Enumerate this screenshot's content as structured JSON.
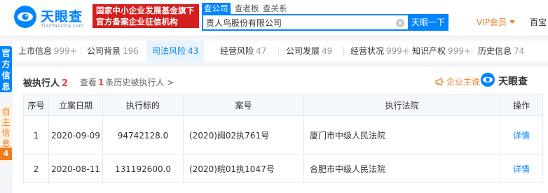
{
  "header": {
    "logo": {
      "name": "天眼查",
      "domain": "TianYanCha.com"
    },
    "banner": {
      "line1": "国家中小企业发展基金旗下",
      "line2": "官方备案企业征信机构"
    },
    "search_tabs": [
      {
        "label": "查公司",
        "active": true
      },
      {
        "label": "查老板",
        "active": false
      },
      {
        "label": "查关系",
        "active": false
      }
    ],
    "search": {
      "value": "贵人鸟股份有限公司",
      "button_label": "天眼一下"
    },
    "vip_label": "VIP会员",
    "app_label": "百宝"
  },
  "sidebar": {
    "official_label": "官方信息",
    "self_label": "自主信息",
    "self_count": "4"
  },
  "category_tabs": [
    {
      "label": "上市信息",
      "count": "999+",
      "active": false
    },
    {
      "label": "公司背景",
      "count": "196",
      "active": false
    },
    {
      "label": "司法风险",
      "count": "43",
      "active": true
    },
    {
      "label": "经营风险",
      "count": "47",
      "active": false
    },
    {
      "label": "公司发展",
      "count": "49",
      "active": false
    },
    {
      "label": "经营状况",
      "count": "999+",
      "active": false
    },
    {
      "label": "知识产权",
      "count": "999+",
      "active": false
    },
    {
      "label": "历史信息",
      "count": "74",
      "active": false
    }
  ],
  "section": {
    "title": "被执行人",
    "count": "2",
    "history_prefix": "查看",
    "history_count": "1",
    "history_suffix": "条历史被执行人 >",
    "owner_link": "企业主说",
    "brand": "天眼查"
  },
  "table": {
    "headers": [
      "序号",
      "立案日期",
      "执行标的",
      "案号",
      "执行法院",
      "操作"
    ],
    "rows": [
      {
        "index": "1",
        "date": "2020-09-09",
        "amount": "94742128.0",
        "case_no": "(2020)闽02执761号",
        "court": "厦门市中级人民法院",
        "action": "详情"
      },
      {
        "index": "2",
        "date": "2020-08-11",
        "amount": "131192600.0",
        "case_no": "(2020)皖01执1047号",
        "court": "合肥市中级人民法院",
        "action": "详情"
      }
    ]
  },
  "colors": {
    "brand_blue": "#0084ff",
    "banner_red": "#d41f1f",
    "accent_orange": "#f37b1d",
    "count_red": "#f04040"
  },
  "icons": [
    "tianyancha-logo-icon",
    "clear-icon",
    "chevron-down-icon",
    "megaphone-icon",
    "tianyancha-brand-icon"
  ]
}
